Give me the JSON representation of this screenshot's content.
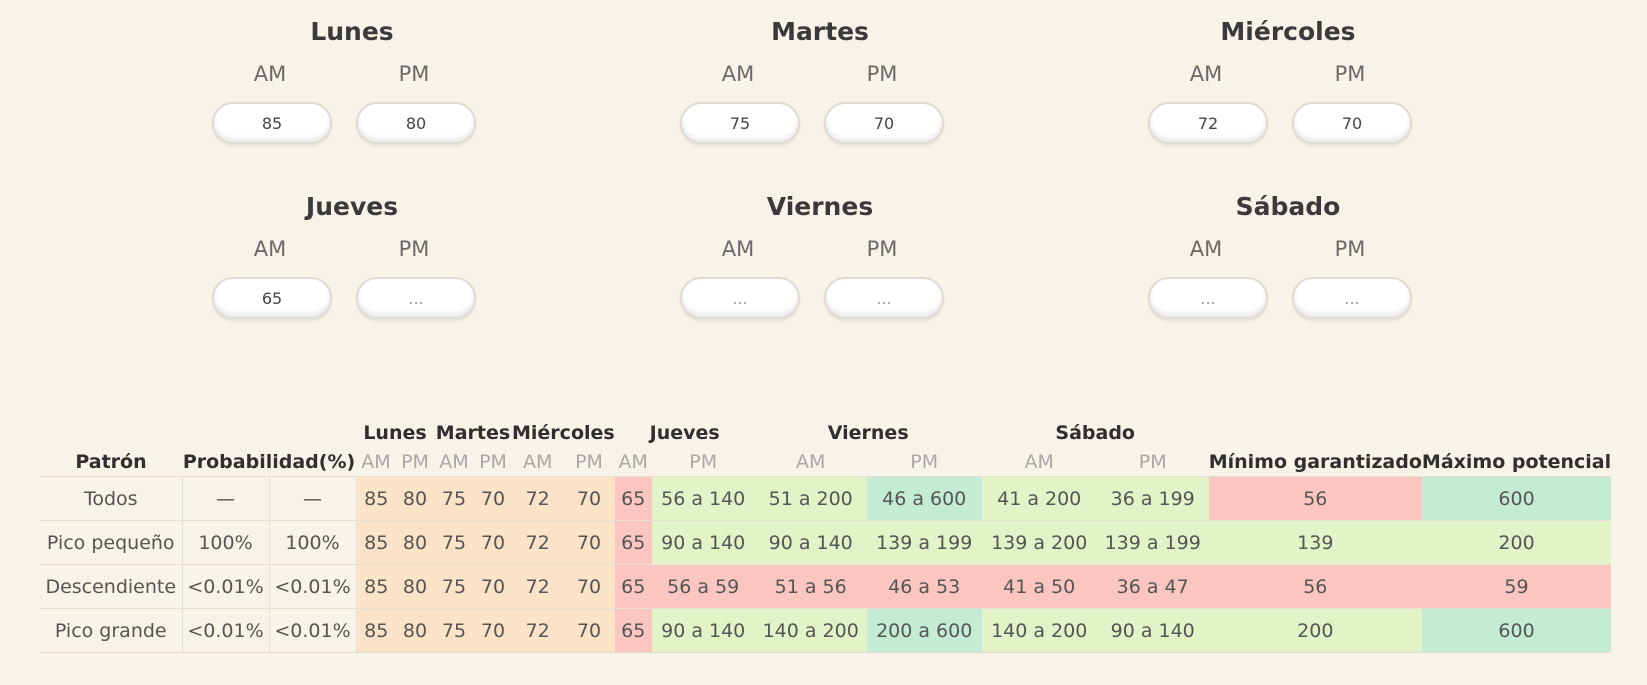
{
  "days": [
    {
      "name": "Lunes",
      "am_label": "AM",
      "pm_label": "PM",
      "am": "85",
      "pm": "80",
      "am_placeholder": "...",
      "pm_placeholder": "..."
    },
    {
      "name": "Martes",
      "am_label": "AM",
      "pm_label": "PM",
      "am": "75",
      "pm": "70",
      "am_placeholder": "...",
      "pm_placeholder": "..."
    },
    {
      "name": "Miércoles",
      "am_label": "AM",
      "pm_label": "PM",
      "am": "72",
      "pm": "70",
      "am_placeholder": "...",
      "pm_placeholder": "..."
    },
    {
      "name": "Jueves",
      "am_label": "AM",
      "pm_label": "PM",
      "am": "65",
      "pm": "",
      "am_placeholder": "...",
      "pm_placeholder": "..."
    },
    {
      "name": "Viernes",
      "am_label": "AM",
      "pm_label": "PM",
      "am": "",
      "pm": "",
      "am_placeholder": "...",
      "pm_placeholder": "..."
    },
    {
      "name": "Sábado",
      "am_label": "AM",
      "pm_label": "PM",
      "am": "",
      "pm": "",
      "am_placeholder": "...",
      "pm_placeholder": "..."
    }
  ],
  "table": {
    "day_headers": [
      "Lunes",
      "Martes",
      "Miércoles",
      "Jueves",
      "Viernes",
      "Sábado"
    ],
    "col_patron": "Patrón",
    "col_prob": "Probabilidad(%)",
    "am": "AM",
    "pm": "PM",
    "col_min": "Mínimo garantizado",
    "col_max": "Máximo potencial",
    "rows": [
      {
        "pattern": "Todos",
        "prob1": "—",
        "prob2": "—",
        "values": [
          "85",
          "80",
          "75",
          "70",
          "72",
          "70",
          "65",
          "56 a 140",
          "51 a 200",
          "46 a 600",
          "41 a 200",
          "36 a 199"
        ],
        "min": "56",
        "max": "600"
      },
      {
        "pattern": "Pico pequeño",
        "prob1": "100%",
        "prob2": "100%",
        "values": [
          "85",
          "80",
          "75",
          "70",
          "72",
          "70",
          "65",
          "90 a 140",
          "90 a 140",
          "139 a 199",
          "139 a 200",
          "139 a 199"
        ],
        "min": "139",
        "max": "200"
      },
      {
        "pattern": "Descendiente",
        "prob1": "<0.01%",
        "prob2": "<0.01%",
        "values": [
          "85",
          "80",
          "75",
          "70",
          "72",
          "70",
          "65",
          "56 a 59",
          "51 a 56",
          "46 a 53",
          "41 a 50",
          "36 a 47"
        ],
        "min": "56",
        "max": "59"
      },
      {
        "pattern": "Pico grande",
        "prob1": "<0.01%",
        "prob2": "<0.01%",
        "values": [
          "85",
          "80",
          "75",
          "70",
          "72",
          "70",
          "65",
          "90 a 140",
          "140 a 200",
          "200 a 600",
          "140 a 200",
          "90 a 140"
        ],
        "min": "200",
        "max": "600"
      }
    ]
  },
  "colors": {
    "known_value": "#fbe3c8",
    "low": "#fcc6c0",
    "mid": "#e1f3c7",
    "high": "#c4ecd5"
  },
  "cell_levels": [
    [
      "k",
      "k",
      "k",
      "k",
      "k",
      "k",
      "low",
      "mid",
      "mid",
      "high",
      "mid",
      "mid",
      "low",
      "high"
    ],
    [
      "k",
      "k",
      "k",
      "k",
      "k",
      "k",
      "low",
      "mid",
      "mid",
      "mid",
      "mid",
      "mid",
      "mid",
      "mid"
    ],
    [
      "k",
      "k",
      "k",
      "k",
      "k",
      "k",
      "low",
      "low",
      "low",
      "low",
      "low",
      "low",
      "low",
      "low"
    ],
    [
      "k",
      "k",
      "k",
      "k",
      "k",
      "k",
      "low",
      "mid",
      "mid",
      "high",
      "mid",
      "mid",
      "mid",
      "high"
    ]
  ]
}
